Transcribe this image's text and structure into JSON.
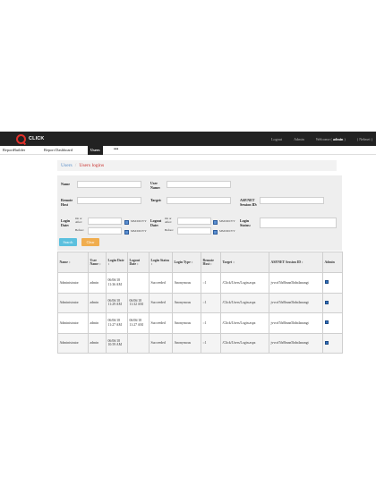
{
  "app": {
    "logo_text": "CLICK"
  },
  "topbar": {
    "logout": "Logout",
    "admin": "Admin",
    "welcome_prefix": "Welcome (",
    "welcome_user": "admin",
    "welcome_suffix": ")",
    "role": "( Nelmei )"
  },
  "tabs": [
    "ReportBuilder",
    "Report Dashboard",
    "Users",
    "•••"
  ],
  "breadcrumb": {
    "root": "Users",
    "separator": "/",
    "current": "Users logins"
  },
  "filters": {
    "name": "Name",
    "user_name": "User Name:",
    "remote_host": "Remote Host",
    "target": "Target:",
    "session_id": "ASP.NET Session ID:",
    "login_date": "Login Date:",
    "logout_date": "Logout Date:",
    "login_status": "Login Status:",
    "on_or_after": "On or After:",
    "before": "Before:",
    "date_hint": "MM/DD/YY",
    "search_button": "Search",
    "clear_button": "Clear"
  },
  "table": {
    "columns": [
      "Name ↕",
      "User Name ↕",
      "Login Date ↕",
      "Logout Date ↕",
      "Login Status ↕",
      "Login Type ↕",
      "Remote Host ↕",
      "Target ↕",
      "ASP.NET Session ID ↕",
      "Admin"
    ],
    "rows": [
      {
        "name": "Administrator",
        "user": "admin",
        "login": "06/06/18 11:36 AM",
        "logout": "",
        "status": "Succeeded",
        "type": "Anonymous",
        "host": "::1",
        "target": "/Click/Users/Login.aspx",
        "session": "jvvcrf5fs0bsnn5hdn4snangt",
        "admin": true
      },
      {
        "name": "Administrator",
        "user": "admin",
        "login": "06/06/18 11:29 AM",
        "logout": "06/06/18 11:32 AM",
        "status": "Succeeded",
        "type": "Anonymous",
        "host": "::1",
        "target": "/Click/Users/Login.aspx",
        "session": "jvvcrf5fs0bsnn5hdn4snangt",
        "admin": true
      },
      {
        "name": "Administrator",
        "user": "admin",
        "login": "06/06/18 11:27 AM",
        "logout": "06/06/18 11:27 AM",
        "status": "Succeeded",
        "type": "Anonymous",
        "host": "::1",
        "target": "/Click/Users/Login.aspx",
        "session": "jvvcrf5fs0bsnn5hdn4snangt",
        "admin": true
      },
      {
        "name": "Administrator",
        "user": "admin",
        "login": "06/06/18 10:59 AM",
        "logout": "",
        "status": "Succeeded",
        "type": "Anonymous",
        "host": "::1",
        "target": "/Click/Users/Login.aspx",
        "session": "jvvcrf5fs0bsnn5hdn4snangt",
        "admin": true
      }
    ]
  },
  "colors": {
    "topbar": "#222222",
    "accent": "#e0302a",
    "link": "#5a8fc9",
    "search": "#5bc0de",
    "clear": "#f0ad4e"
  }
}
